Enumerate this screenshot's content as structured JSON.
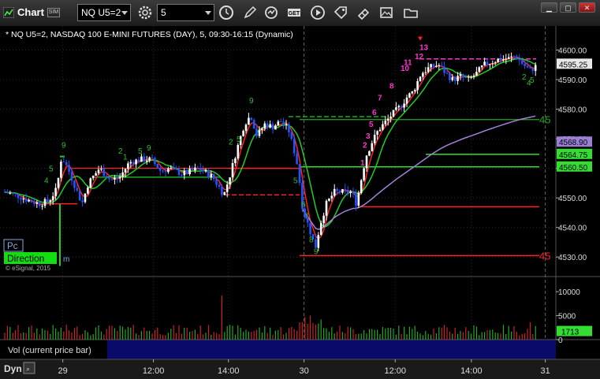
{
  "window": {
    "title": "Chart",
    "sim_badge": "SIM",
    "symbol": "NQ U5=2",
    "interval": "5",
    "toolbar_icons": [
      "cursor-icon",
      "pencil-icon",
      "refresh-icon",
      "get-icon",
      "play-icon",
      "tag-icon",
      "image-icon",
      "folder-icon"
    ]
  },
  "header": {
    "description": "* NQ U5=2, NASDAQ 100 E-MINI FUTURES (DAY), 5, 09:30-16:15 (Dynamic)"
  },
  "price_axis": {
    "ticks": [
      "4600.00",
      "4590.00",
      "4580.00",
      "4570.00",
      "4560.00",
      "4550.00",
      "4540.00",
      "4530.00"
    ],
    "tick_values": [
      4600,
      4590,
      4580,
      4570,
      4560,
      4550,
      4540,
      4530
    ],
    "min": 4525,
    "max": 4606,
    "tags": [
      {
        "label": "4595.25",
        "value": 4595.25,
        "bg": "#e8e8e8",
        "fg": "#000"
      },
      {
        "label": "4568.90",
        "value": 4568.9,
        "bg": "#9b7fd4",
        "fg": "#000"
      },
      {
        "label": "4564.75",
        "value": 4564.75,
        "bg": "#33dd33",
        "fg": "#000"
      },
      {
        "label": "4560.50",
        "value": 4560.5,
        "bg": "#33dd33",
        "fg": "#000"
      }
    ]
  },
  "levels": [
    {
      "label": "45",
      "value": 4576.5,
      "color": "#22aa22"
    },
    {
      "label": "45",
      "value": 4530.5,
      "color": "#ff2222"
    }
  ],
  "volume_axis": {
    "ticks": [
      "10000",
      "5000",
      "0"
    ],
    "tick_values": [
      10000,
      5000,
      0
    ],
    "max": 12500,
    "tag": {
      "label": "1713",
      "value": 1713
    }
  },
  "time_axis": {
    "labels": [
      "29",
      "12:00",
      "14:00",
      "30",
      "12:00",
      "14:00",
      "31"
    ],
    "positions": [
      0.113,
      0.276,
      0.411,
      0.547,
      0.711,
      0.848,
      0.981
    ]
  },
  "indicators": {
    "pc_label": "Pc",
    "direction_label": "Direction",
    "direction_suffix": "m",
    "copyright": "© eSignal, 2015",
    "volume_pane_title": "Vol (current price bar)",
    "dyn_label": "Dyn"
  },
  "colors": {
    "up": "#ffffff",
    "down": "#2255ff",
    "fast_ma": "#ff2222",
    "slow_ma": "#22cc22",
    "vwap": "#a680d8",
    "seq_magenta": "#ff33cc",
    "seq_green": "#33bb33"
  }
}
